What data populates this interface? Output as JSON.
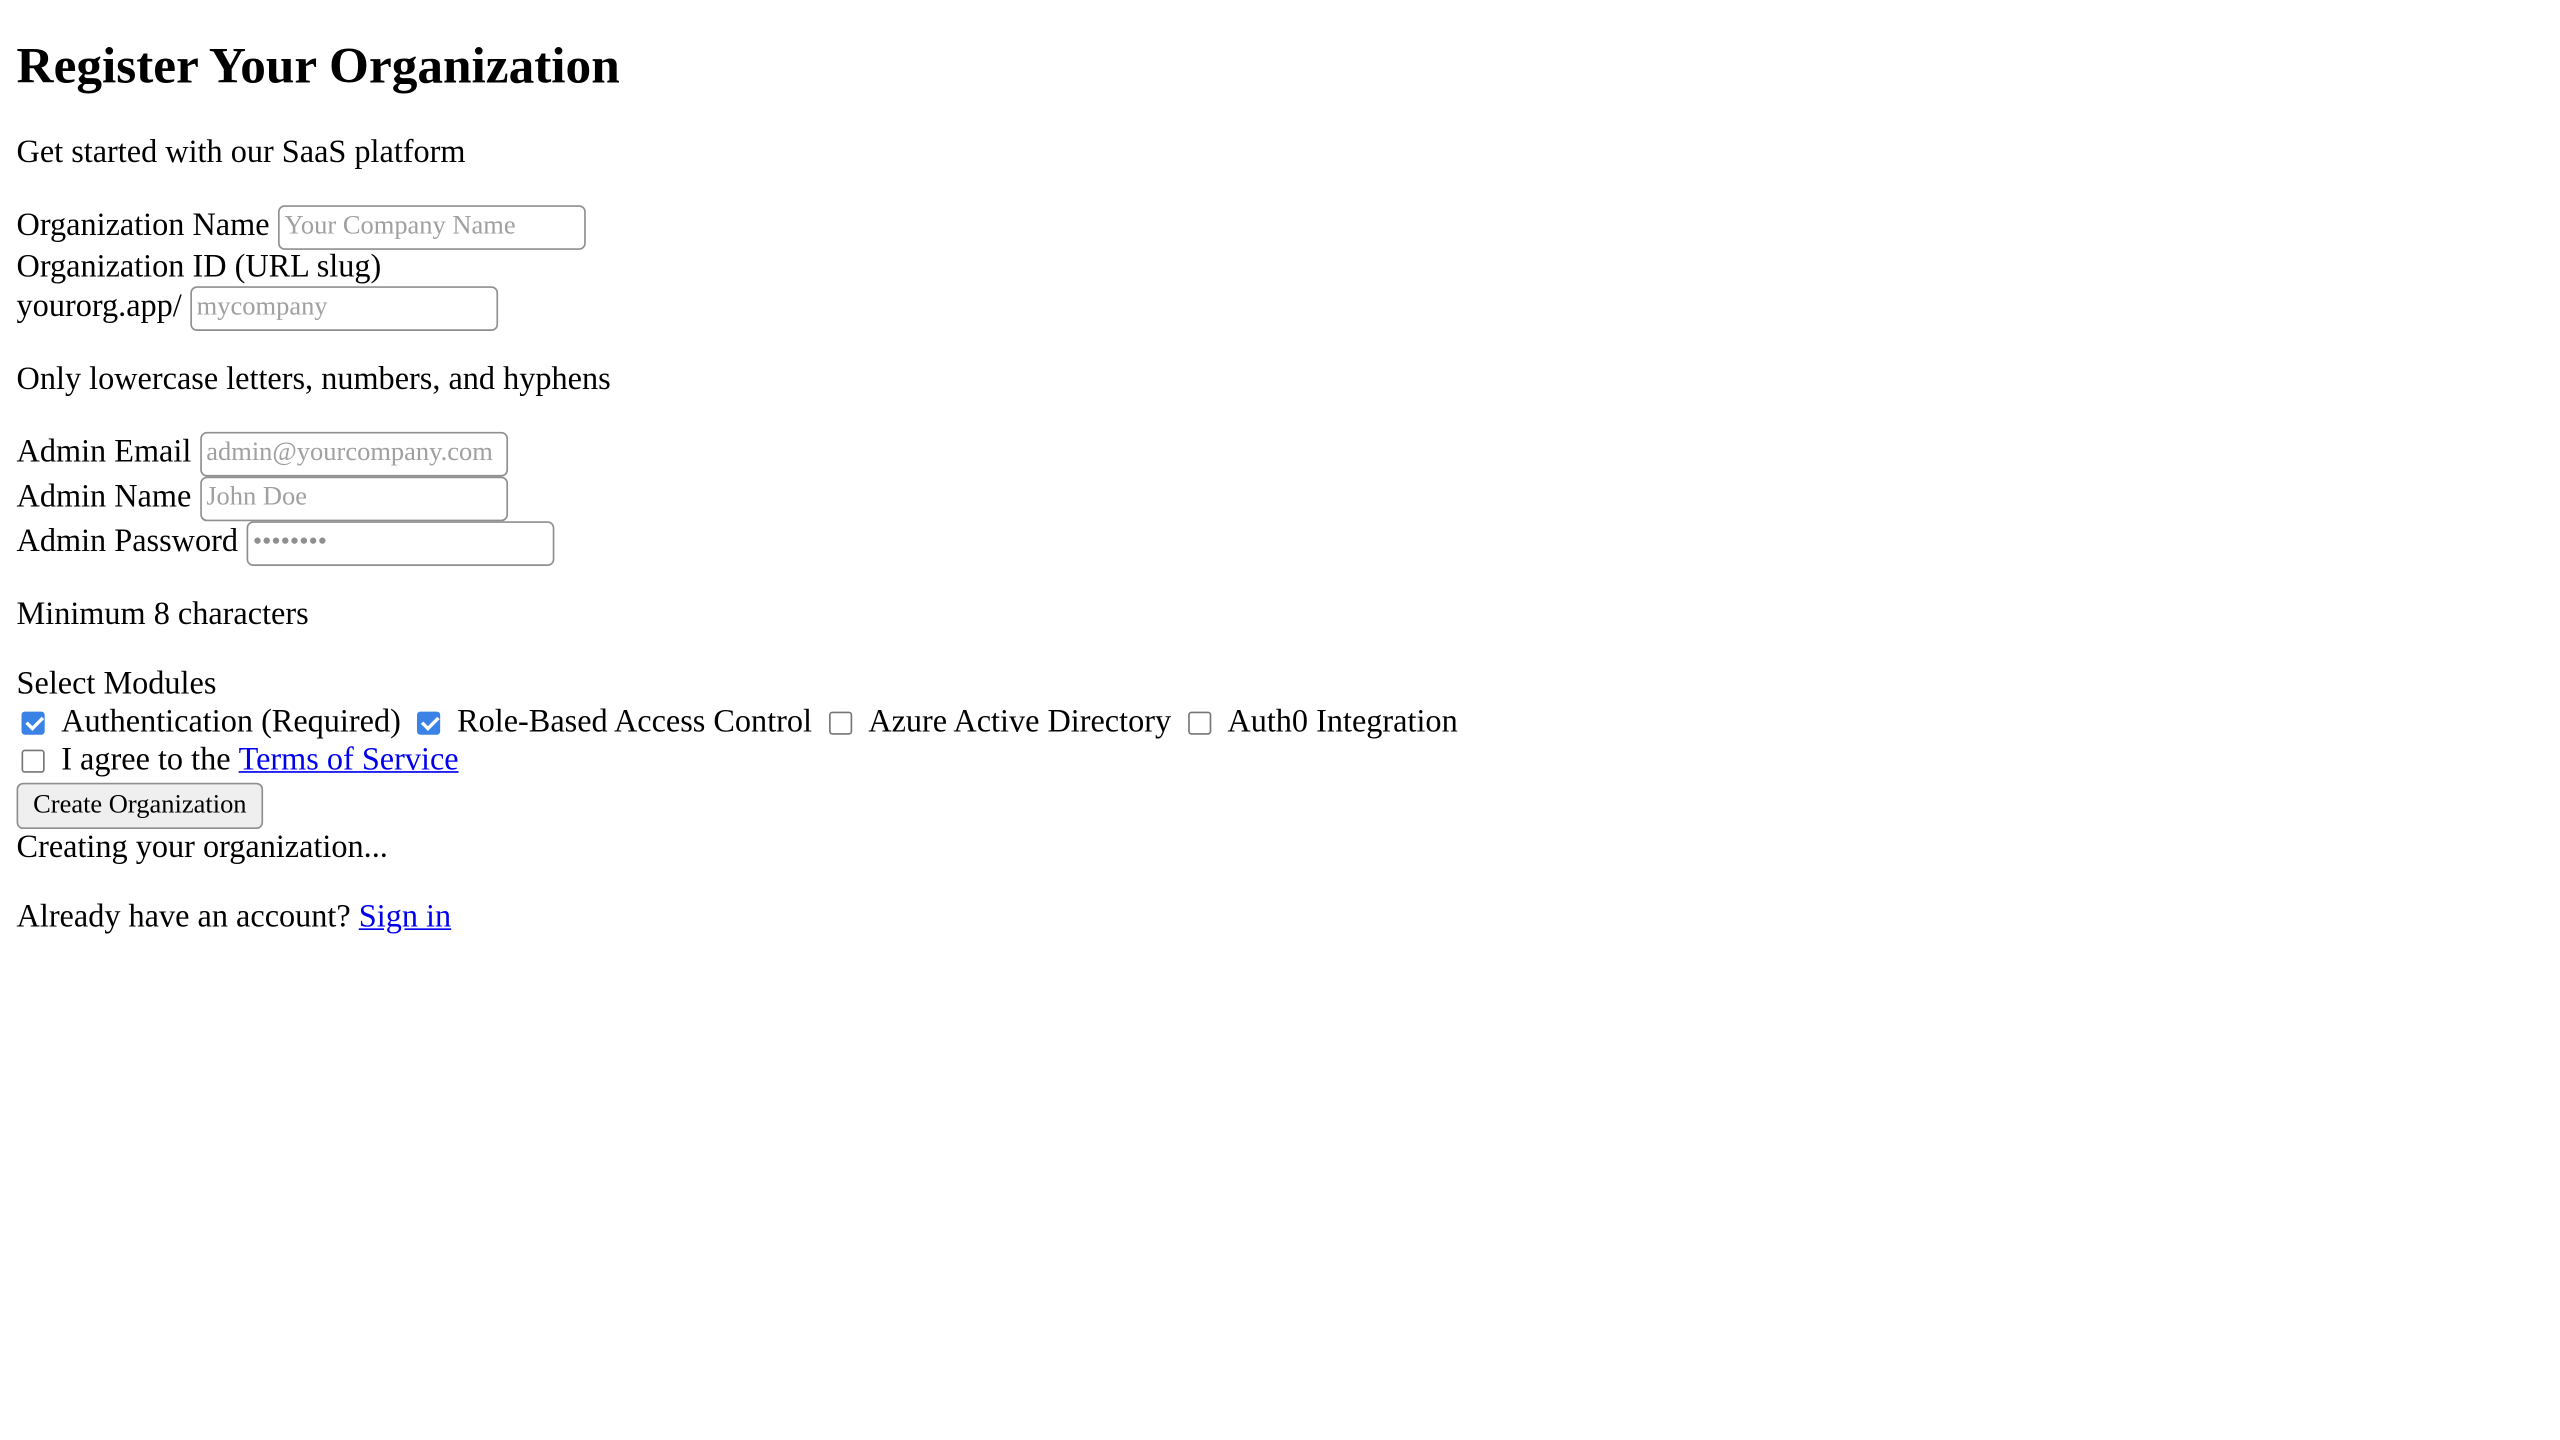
{
  "header": {
    "title": "Register Your Organization",
    "subtitle": "Get started with our SaaS platform"
  },
  "form": {
    "org_name": {
      "label": "Organization Name",
      "placeholder": "Your Company Name",
      "value": ""
    },
    "org_id": {
      "label": "Organization ID (URL slug)",
      "prefix": "yourorg.app/",
      "placeholder": "mycompany",
      "value": "",
      "hint": "Only lowercase letters, numbers, and hyphens"
    },
    "admin_email": {
      "label": "Admin Email",
      "placeholder": "admin@yourcompany.com",
      "value": ""
    },
    "admin_name": {
      "label": "Admin Name",
      "placeholder": "John Doe",
      "value": ""
    },
    "admin_password": {
      "label": "Admin Password",
      "placeholder": "••••••••",
      "value": "",
      "hint": "Minimum 8 characters"
    },
    "modules": {
      "label": "Select Modules",
      "items": [
        {
          "label": "Authentication (Required)",
          "checked": true
        },
        {
          "label": "Role-Based Access Control",
          "checked": true
        },
        {
          "label": "Azure Active Directory",
          "checked": false
        },
        {
          "label": "Auth0 Integration",
          "checked": false
        }
      ]
    },
    "terms": {
      "prefix": "I agree to the ",
      "link_text": "Terms of Service",
      "checked": false
    },
    "submit_label": "Create Organization",
    "status_text": "Creating your organization..."
  },
  "footer": {
    "prompt": "Already have an account? ",
    "link_text": "Sign in"
  },
  "colors": {
    "checkbox_checked": "#3b82e6",
    "link": "#0000ee",
    "placeholder": "#a0a0a0"
  }
}
